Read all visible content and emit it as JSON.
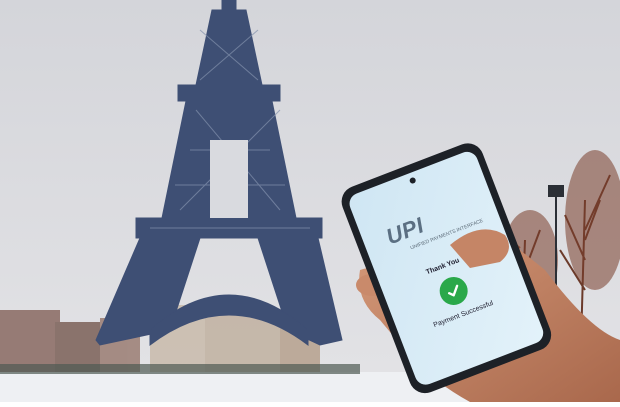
{
  "phone": {
    "brand": "UPI",
    "tagline": "UNIFIED PAYMENTS INTERFACE",
    "thank_you": "Thank You",
    "status": "Payment Successful"
  },
  "colors": {
    "sky": "#d9dbe0",
    "tower": "#3e4f74",
    "snow": "#f2f3f5",
    "phone_body": "#1d2127",
    "screen": "#d6ebf6",
    "success_green": "#2aa84a",
    "hand": "#c98a6b"
  },
  "icons": [
    "check-icon",
    "upi-logo-icon"
  ]
}
